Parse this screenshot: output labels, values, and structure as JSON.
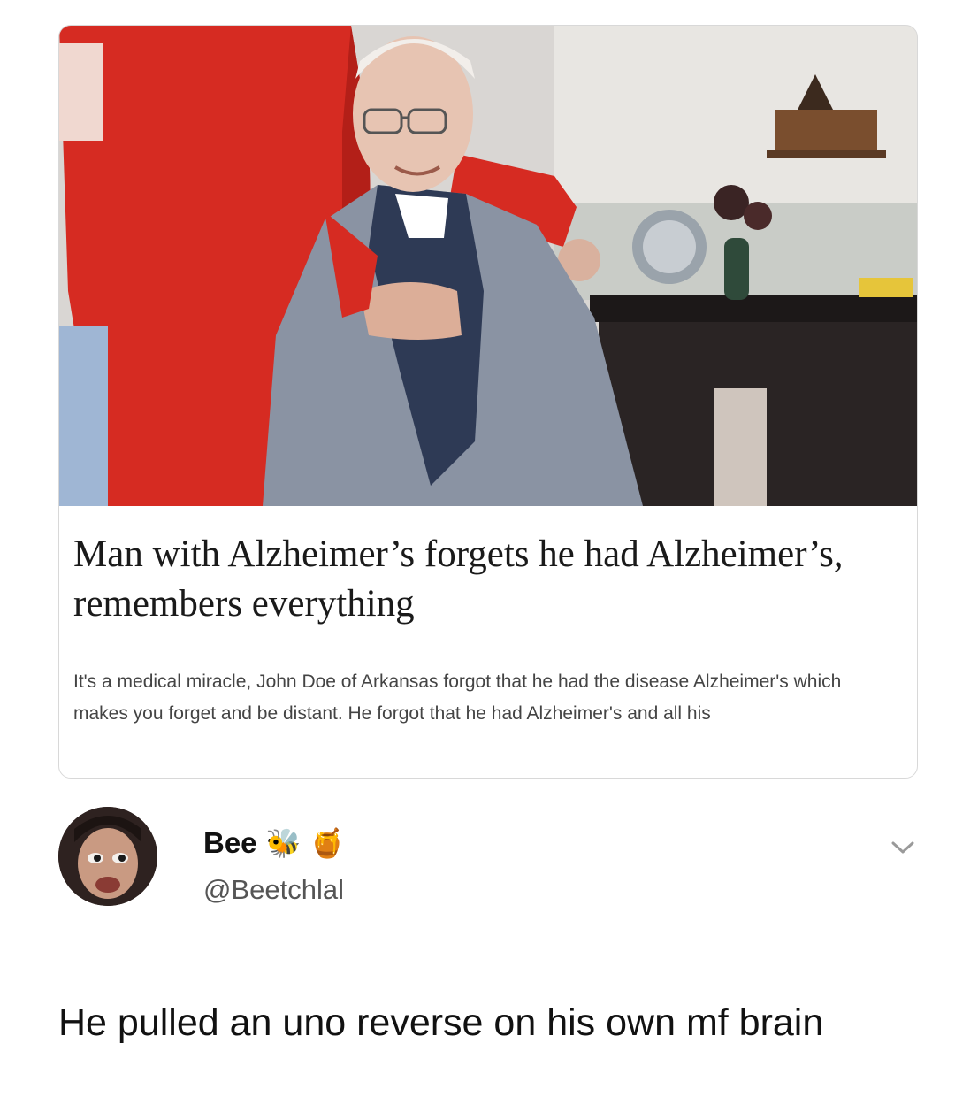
{
  "article": {
    "image_alt": "Elderly man in a grey jacket sitting, with a person in red standing beside him",
    "headline": "Man with Alzheimer’s forgets he had Alzheimer’s, remembers everything",
    "snippet": "It's a medical miracle, John Doe of Arkansas forgot that he had the disease Alzheimer's which makes you forget and be distant. He forgot that he had Alzheimer's and all his"
  },
  "tweet": {
    "display_name": "Bee",
    "name_emojis": [
      "🐝",
      "🍯"
    ],
    "handle": "@Beetchlal",
    "text": "He pulled an uno reverse on his own mf brain",
    "menu_icon": "chevron-down-icon"
  },
  "colors": {
    "card_border": "#d8d8d8",
    "handle_gray": "#555555",
    "red_shirt": "#d62b22",
    "grey_jacket": "#8a93a3"
  }
}
